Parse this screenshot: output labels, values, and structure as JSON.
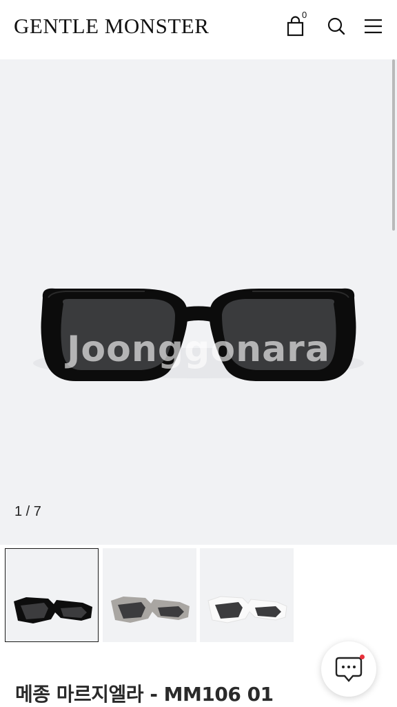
{
  "header": {
    "logo_text": "GENTLE MONSTER",
    "cart_count": "0",
    "icons": [
      "shopping-bag-icon",
      "search-icon",
      "hamburger-menu-icon"
    ]
  },
  "gallery": {
    "watermark": "Joonggonara",
    "counter": "1 / 7",
    "current_index": 1,
    "total": 7,
    "thumbnails": [
      {
        "variant": "black",
        "selected": true
      },
      {
        "variant": "gray",
        "selected": false
      },
      {
        "variant": "white",
        "selected": false
      }
    ]
  },
  "product": {
    "title": "메종 마르지엘라 - MM106 01"
  },
  "colors": {
    "background": "#f1f2f4",
    "text": "#1a1a1a",
    "notification_dot": "#e8323c"
  }
}
